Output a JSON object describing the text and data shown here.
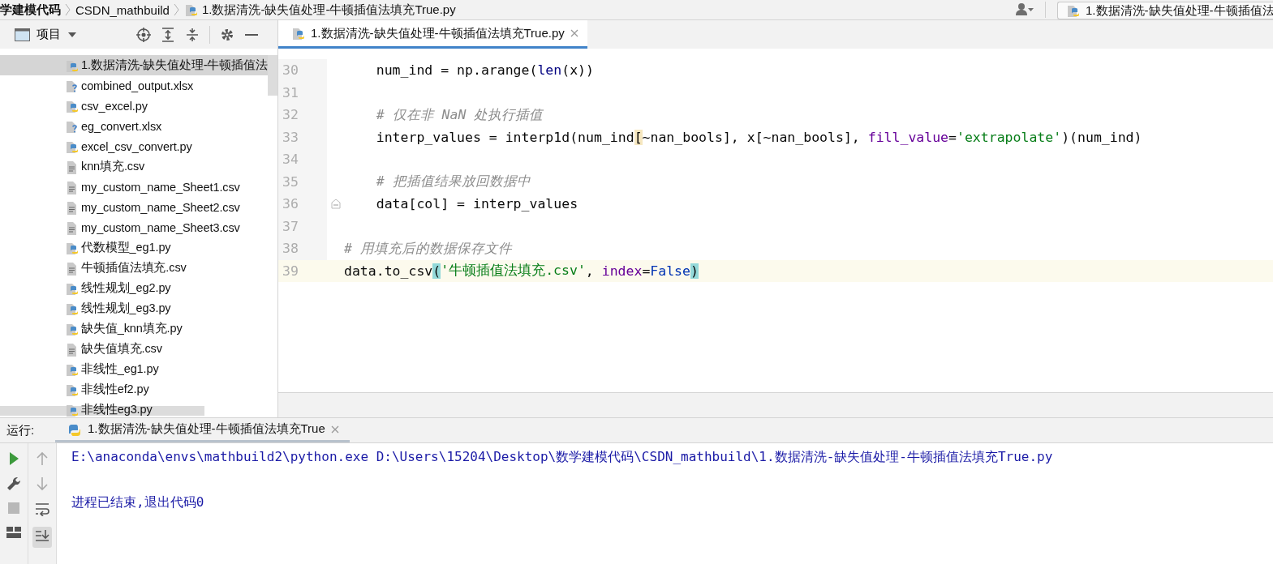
{
  "breadcrumb": [
    {
      "label": "学建模代码"
    },
    {
      "label": "CSDN_mathbuild"
    },
    {
      "label": "1.数据清洗-缺失值处理-牛顿插值法填充True.py"
    }
  ],
  "run_config": {
    "label": "1.数据清洗-缺失值处理-牛顿插值法"
  },
  "project_panel": {
    "title": "项目"
  },
  "project_tree": [
    {
      "label": "1.数据清洗-缺失值处理-牛顿插值法",
      "kind": "python",
      "selected": true
    },
    {
      "label": "combined_output.xlsx",
      "kind": "unknown",
      "selected": false
    },
    {
      "label": "csv_excel.py",
      "kind": "python",
      "selected": false
    },
    {
      "label": "eg_convert.xlsx",
      "kind": "unknown",
      "selected": false
    },
    {
      "label": "excel_csv_convert.py",
      "kind": "python",
      "selected": false
    },
    {
      "label": "knn填充.csv",
      "kind": "text",
      "selected": false
    },
    {
      "label": "my_custom_name_Sheet1.csv",
      "kind": "text",
      "selected": false
    },
    {
      "label": "my_custom_name_Sheet2.csv",
      "kind": "text",
      "selected": false
    },
    {
      "label": "my_custom_name_Sheet3.csv",
      "kind": "text",
      "selected": false
    },
    {
      "label": "代数模型_eg1.py",
      "kind": "python",
      "selected": false
    },
    {
      "label": "牛顿插值法填充.csv",
      "kind": "text",
      "selected": false
    },
    {
      "label": "线性规划_eg2.py",
      "kind": "python",
      "selected": false
    },
    {
      "label": "线性规划_eg3.py",
      "kind": "python",
      "selected": false
    },
    {
      "label": "缺失值_knn填充.py",
      "kind": "python",
      "selected": false
    },
    {
      "label": "缺失值填充.csv",
      "kind": "text",
      "selected": false
    },
    {
      "label": "非线性_eg1.py",
      "kind": "python",
      "selected": false
    },
    {
      "label": "非线性ef2.py",
      "kind": "python",
      "selected": false
    },
    {
      "label": "非线性eg3.py",
      "kind": "python",
      "selected": false
    }
  ],
  "editor_tabs": [
    {
      "label": "1.数据清洗-缺失值处理-牛顿插值法填充True.py",
      "selected": true
    }
  ],
  "code_lines": [
    {
      "number": "30",
      "current": false,
      "fold": false,
      "tokens": [
        {
          "text": "    num_ind = np.arange(",
          "kind": "plain"
        },
        {
          "text": "len",
          "kind": "builtin"
        },
        {
          "text": "(x))",
          "kind": "plain"
        }
      ]
    },
    {
      "number": "31",
      "current": false,
      "fold": false
    },
    {
      "number": "32",
      "current": false,
      "fold": false,
      "tokens": [
        {
          "text": "    # 仅在非 NaN 处执行插值",
          "kind": "comment"
        }
      ]
    },
    {
      "number": "33",
      "current": false,
      "fold": false,
      "tokens": [
        {
          "text": "    interp_values = interp1d(num_ind",
          "kind": "plain"
        },
        {
          "text": "[",
          "kind": "match-warm"
        },
        {
          "text": "~nan_bools], x[~nan_bools], ",
          "kind": "plain"
        },
        {
          "text": "fill_value",
          "kind": "named-arg"
        },
        {
          "text": "=",
          "kind": "plain"
        },
        {
          "text": "'extrapolate'",
          "kind": "string"
        },
        {
          "text": ")(num_ind)",
          "kind": "plain"
        }
      ]
    },
    {
      "number": "34",
      "current": false,
      "fold": false
    },
    {
      "number": "35",
      "current": false,
      "fold": false,
      "tokens": [
        {
          "text": "    # 把插值结果放回数据中",
          "kind": "comment"
        }
      ]
    },
    {
      "number": "36",
      "current": false,
      "fold": true,
      "tokens": [
        {
          "text": "    data[col] = interp_values",
          "kind": "plain"
        }
      ]
    },
    {
      "number": "37",
      "current": false,
      "fold": false
    },
    {
      "number": "38",
      "current": false,
      "fold": false,
      "tokens": [
        {
          "text": "# 用填充后的数据保存文件",
          "kind": "comment"
        }
      ]
    },
    {
      "number": "39",
      "current": true,
      "fold": false,
      "tokens": [
        {
          "text": "data.to_csv",
          "kind": "plain"
        },
        {
          "text": "(",
          "kind": "match-cool"
        },
        {
          "text": "'牛顿插值法填充.csv'",
          "kind": "string"
        },
        {
          "text": ", ",
          "kind": "plain"
        },
        {
          "text": "index",
          "kind": "named-arg"
        },
        {
          "text": "=",
          "kind": "plain"
        },
        {
          "text": "False",
          "kind": "constant"
        },
        {
          "text": ")",
          "kind": "match-cool"
        }
      ]
    }
  ],
  "run_panel": {
    "label": "运行:",
    "tabs": [
      {
        "label": "1.数据清洗-缺失值处理-牛顿插值法填充True",
        "selected": true
      }
    ],
    "output": [
      "E:\\anaconda\\envs\\mathbuild2\\python.exe D:\\Users\\15204\\Desktop\\数学建模代码\\CSDN_mathbuild\\1.数据清洗-缺失值处理-牛顿插值法填充True.py",
      "进程已结束,退出代码0"
    ]
  }
}
